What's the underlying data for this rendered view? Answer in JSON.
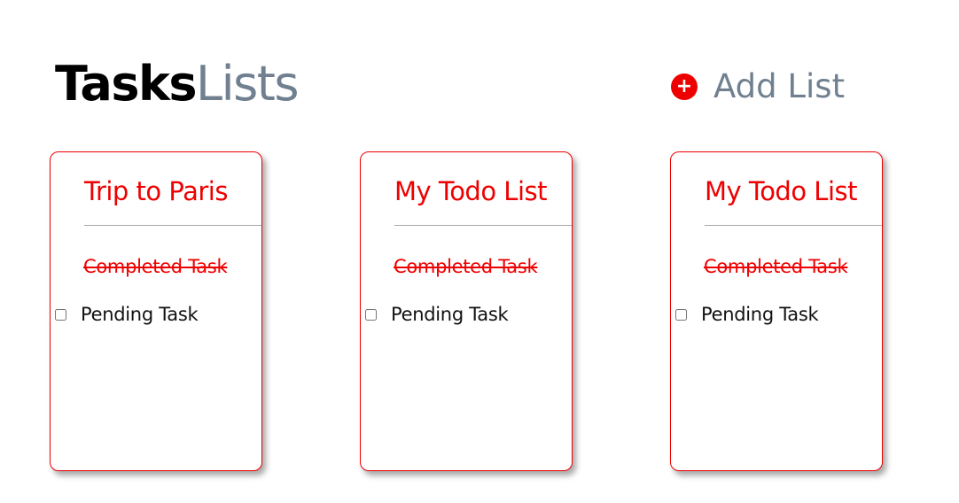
{
  "header": {
    "title_bold": "Tasks",
    "title_light": "Lists",
    "add_list_label": "Add List",
    "add_icon_symbol": "+",
    "add_icon_name": "plus-circle-icon"
  },
  "colors": {
    "accent": "#ee0000",
    "muted": "#708090",
    "text": "#000000"
  },
  "lists": [
    {
      "title": "Trip to Paris",
      "tasks": [
        {
          "label": "Completed Task",
          "completed": true
        },
        {
          "label": "Pending Task",
          "completed": false
        }
      ]
    },
    {
      "title": "My Todo List",
      "tasks": [
        {
          "label": "Completed Task",
          "completed": true
        },
        {
          "label": "Pending Task",
          "completed": false
        }
      ]
    },
    {
      "title": "My Todo List",
      "tasks": [
        {
          "label": "Completed Task",
          "completed": true
        },
        {
          "label": "Pending Task",
          "completed": false
        }
      ]
    }
  ]
}
